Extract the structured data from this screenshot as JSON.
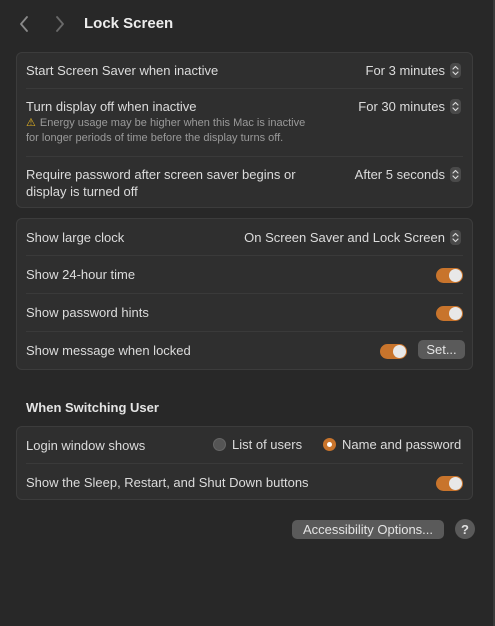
{
  "window": {
    "title": "Lock Screen"
  },
  "screen_saver_group": {
    "start_saver": {
      "label": "Start Screen Saver when inactive",
      "value": "For 3 minutes"
    },
    "display_off": {
      "label": "Turn display off when inactive",
      "value": "For 30 minutes",
      "note_line1": "Energy usage may be higher when this Mac is inactive",
      "note_line2": "for longer periods of time before the display turns off."
    },
    "require_password": {
      "label_line1": "Require password after screen saver begins or",
      "label_line2": "display is turned off",
      "value": "After 5 seconds"
    }
  },
  "clock_group": {
    "large_clock": {
      "label": "Show large clock",
      "value": "On Screen Saver and Lock Screen"
    },
    "hour24": {
      "label": "Show 24-hour time",
      "enabled": true
    },
    "password_hints": {
      "label": "Show password hints",
      "enabled": true
    },
    "message_locked": {
      "label": "Show message when locked",
      "enabled": true,
      "button": "Set..."
    }
  },
  "switching_user": {
    "section_title": "When Switching User",
    "login_window": {
      "label": "Login window shows",
      "options": [
        "List of users",
        "Name and password"
      ],
      "selected": "Name and password"
    },
    "sleep_restart": {
      "label": "Show the Sleep, Restart, and Shut Down buttons",
      "enabled": true
    }
  },
  "footer": {
    "accessibility_button": "Accessibility Options...",
    "help_button": "?"
  },
  "colors": {
    "accent": "#c8742c",
    "background": "#282828",
    "group_background": "#2f2f2f",
    "warning": "#e6b422"
  },
  "icons": {
    "back": "chevron-left-icon",
    "forward": "chevron-right-icon",
    "warning": "warning-triangle-icon",
    "stepper": "up-down-chevron-icon"
  }
}
